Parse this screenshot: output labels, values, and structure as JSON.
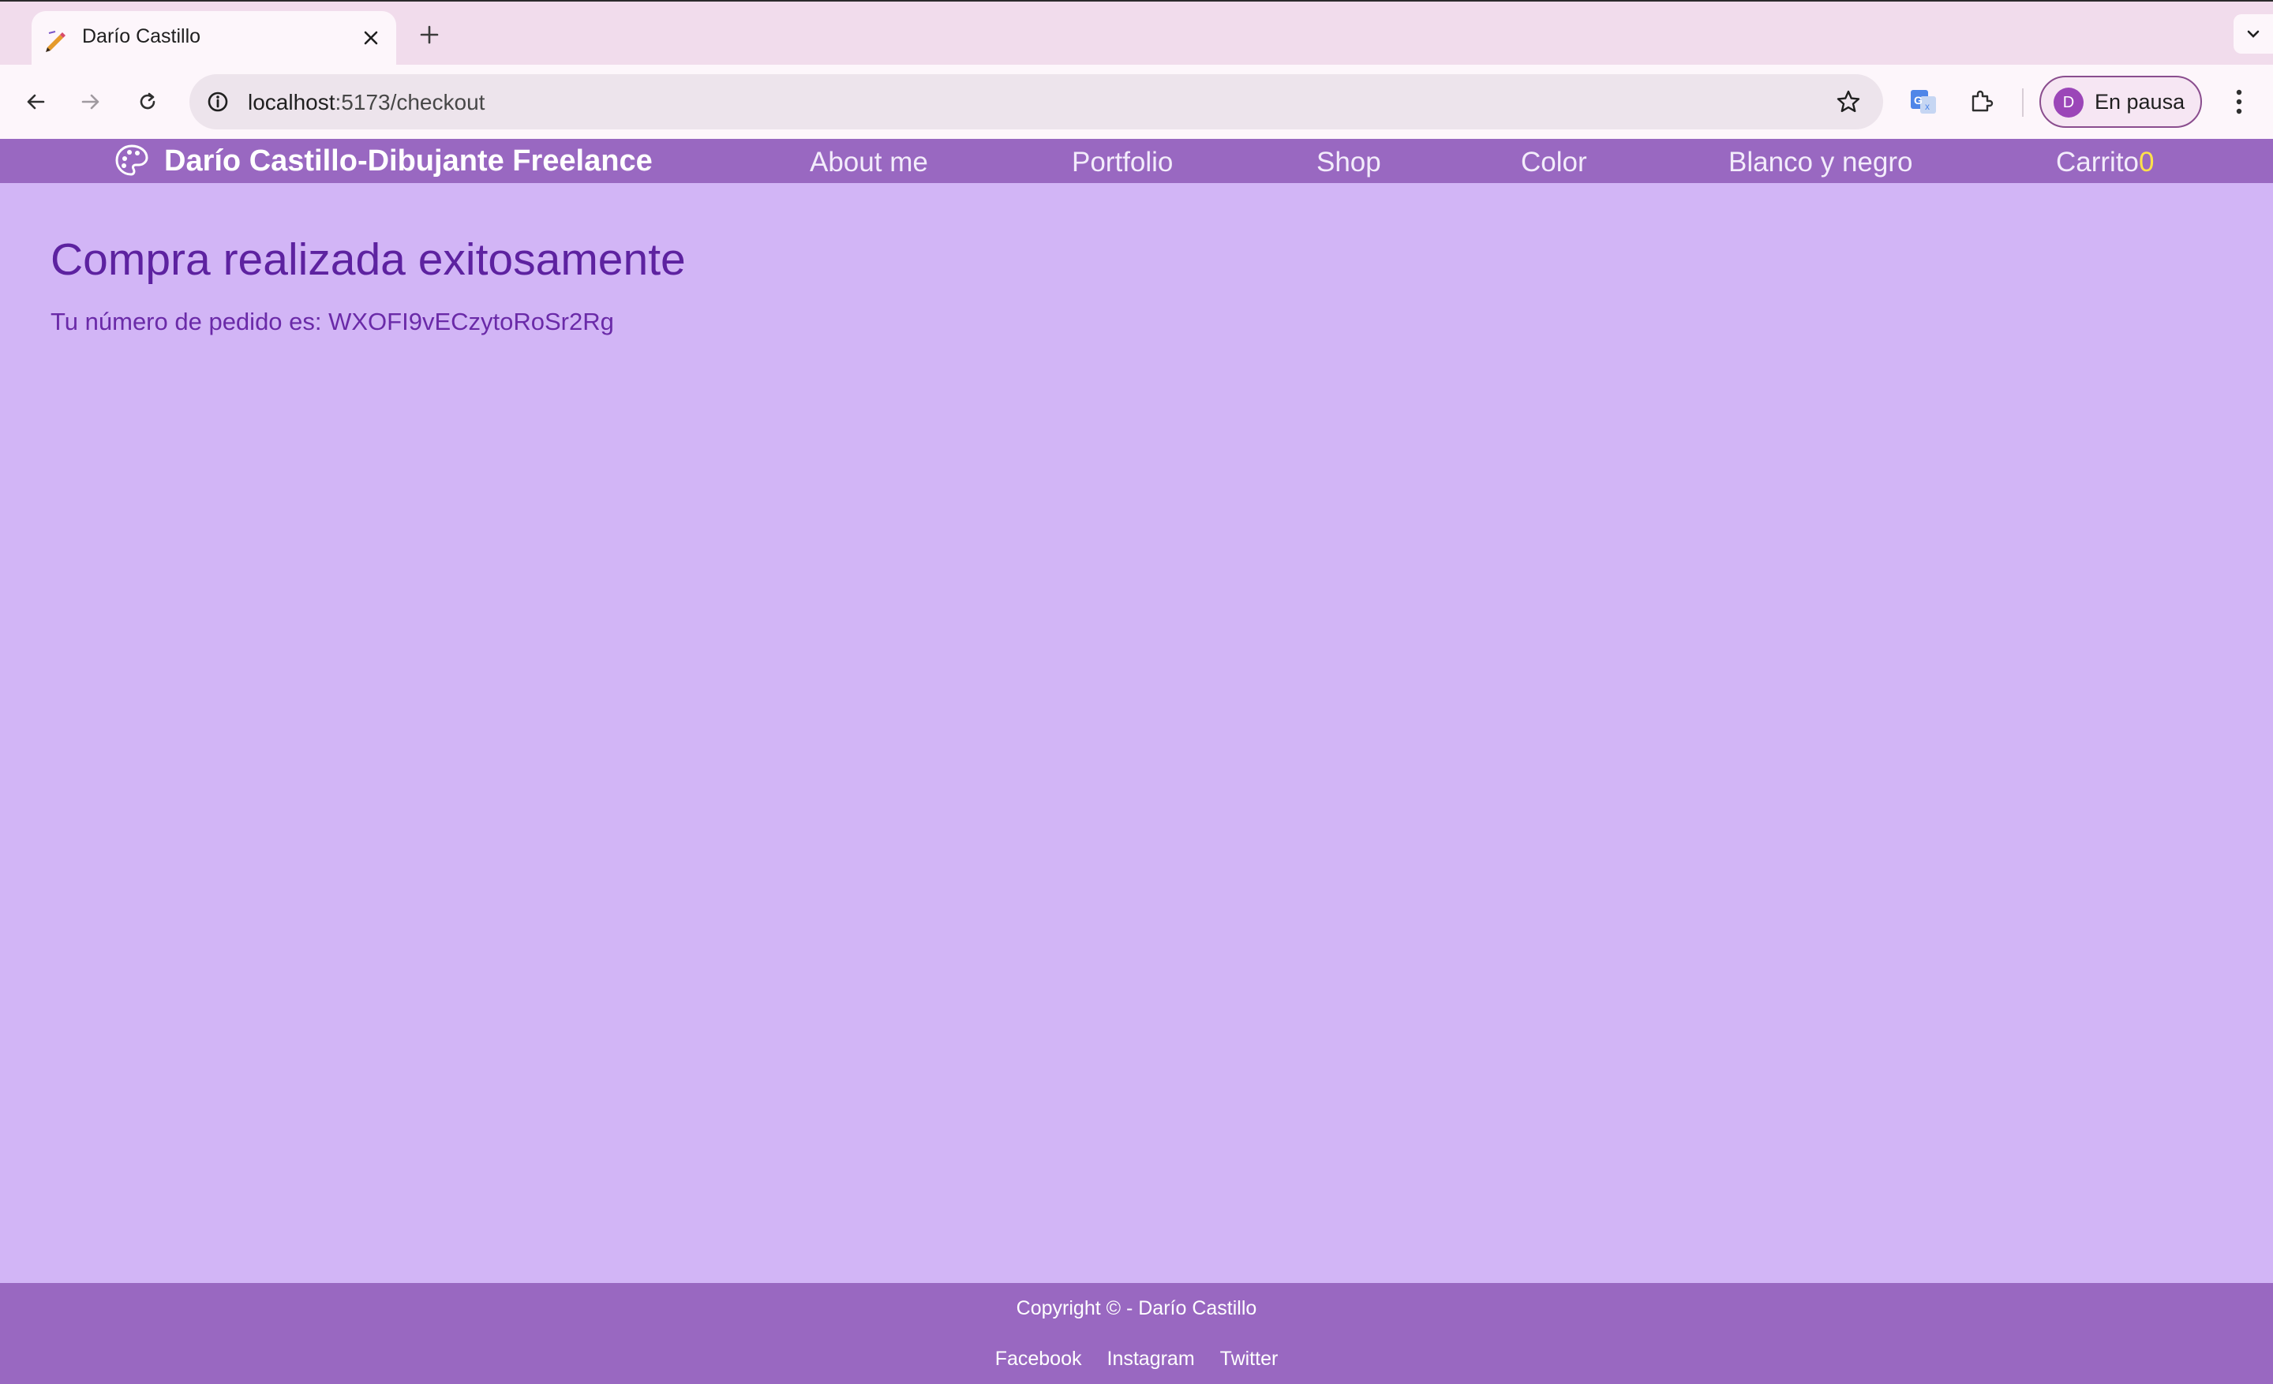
{
  "browser": {
    "tab": {
      "title": "Darío Castillo",
      "favicon": "pencil-icon"
    },
    "address_bar": {
      "host": "localhost",
      "path": ":5173/checkout"
    },
    "profile": {
      "initial": "D",
      "label": "En pausa"
    },
    "icons": {
      "back": "arrow-left-icon",
      "forward": "arrow-right-icon",
      "reload": "reload-icon",
      "site_info": "info-icon",
      "bookmark": "star-icon",
      "translate": "translate-icon",
      "extensions": "puzzle-icon",
      "menu": "kebab-icon"
    }
  },
  "site": {
    "brand": "Darío Castillo-Dibujante Freelance",
    "brand_icon": "palette-icon",
    "nav": {
      "about": "About me",
      "portfolio": "Portfolio",
      "shop": "Shop",
      "color": "Color",
      "bw": "Blanco y negro",
      "cart_label": "Carrito",
      "cart_count": "0"
    }
  },
  "main": {
    "title": "Compra realizada exitosamente",
    "order_text": "Tu número de pedido es: WXOFI9vECzytoRoSr2Rg"
  },
  "footer": {
    "copyright": "Copyright © - Darío Castillo",
    "links": {
      "facebook": "Facebook",
      "instagram": "Instagram",
      "twitter": "Twitter"
    }
  },
  "colors": {
    "page_background": "#d2b5f6",
    "nav_background": "#9968c1",
    "title_text": "#5d22a0",
    "cart_count": "#ffe24a"
  }
}
